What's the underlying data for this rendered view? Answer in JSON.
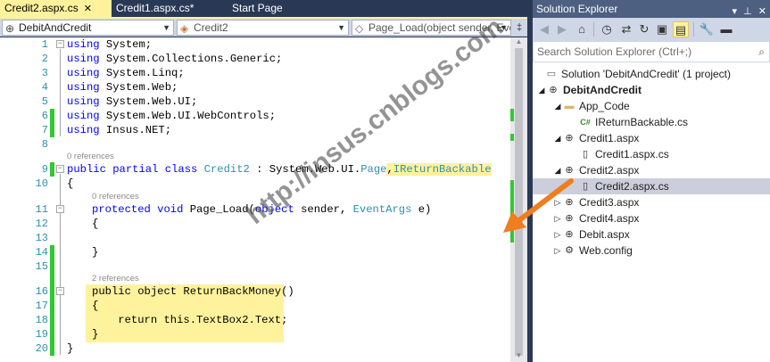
{
  "tabs": [
    {
      "label": "Credit2.aspx.cs",
      "active": true,
      "closable": true
    },
    {
      "label": "Credit1.aspx.cs*",
      "active": false,
      "closable": false
    },
    {
      "label": "Start Page",
      "active": false,
      "closable": false
    }
  ],
  "navbar": {
    "project": "DebitAndCredit",
    "class": "Credit2",
    "member": "Page_Load(object sender, Eve"
  },
  "code": {
    "line_numbers": [
      "1",
      "2",
      "3",
      "4",
      "5",
      "6",
      "7",
      "8",
      "9",
      "10",
      "11",
      "12",
      "13",
      "14",
      "15",
      "16",
      "17",
      "18",
      "19",
      "20"
    ],
    "refs": [
      "0 references",
      "0 references",
      "2 references"
    ],
    "lines": {
      "l1_kw": "using",
      "l1_rest": " System;",
      "l2_kw": "using",
      "l2_rest": " System.Collections.Generic;",
      "l3_kw": "using",
      "l3_rest": " System.Linq;",
      "l4_kw": "using",
      "l4_rest": " System.Web;",
      "l5_kw": "using",
      "l5_rest": " System.Web.UI;",
      "l6_kw": "using",
      "l6_rest": " System.Web.UI.WebControls;",
      "l7_kw": "using",
      "l7_rest": " Insus.NET;",
      "l9_kw1": "public",
      "l9_kw2": "partial",
      "l9_kw3": "class",
      "l9_cls": "Credit2",
      "l9_mid": " : System.Web.UI.",
      "l9_page": "Page",
      "l9_comma": ",",
      "l9_iface": "IReturnBackable",
      "l10": "{",
      "l11_kw1": "protected",
      "l11_kw2": "void",
      "l11_name": " Page_Load(",
      "l11_kw3": "object",
      "l11_sender": " sender, ",
      "l11_type": "EventArgs",
      "l11_e": " e)",
      "l12": "{",
      "l14": "}",
      "l16": "public object ReturnBackMoney()",
      "l17": "{",
      "l18": "    return this.TextBox2.Text;",
      "l19": "}",
      "l20": "}"
    }
  },
  "watermark": "http://insus.cnblogs.com",
  "solution_explorer": {
    "title": "Solution Explorer",
    "search_placeholder": "Search Solution Explorer (Ctrl+;)",
    "tree": [
      {
        "label": "Solution 'DebitAndCredit' (1 project)",
        "icon": "solution-icon"
      },
      {
        "label": "DebitAndCredit",
        "icon": "web-project-icon"
      },
      {
        "label": "App_Code",
        "icon": "folder-icon"
      },
      {
        "label": "IReturnBackable.cs",
        "icon": "csharp-file-icon"
      },
      {
        "label": "Credit1.aspx",
        "icon": "aspx-file-icon"
      },
      {
        "label": "Credit1.aspx.cs",
        "icon": "code-file-icon"
      },
      {
        "label": "Credit2.aspx",
        "icon": "aspx-file-icon"
      },
      {
        "label": "Credit2.aspx.cs",
        "icon": "code-file-icon",
        "selected": true
      },
      {
        "label": "Credit3.aspx",
        "icon": "aspx-file-icon"
      },
      {
        "label": "Credit4.aspx",
        "icon": "aspx-file-icon"
      },
      {
        "label": "Debit.aspx",
        "icon": "aspx-file-icon"
      },
      {
        "label": "Web.config",
        "icon": "config-file-icon"
      }
    ]
  },
  "colors": {
    "highlight": "#fff29d",
    "keyword": "#0000ff",
    "type": "#2b91af",
    "change_bar": "#32c832",
    "arrow": "#f07d1e"
  }
}
